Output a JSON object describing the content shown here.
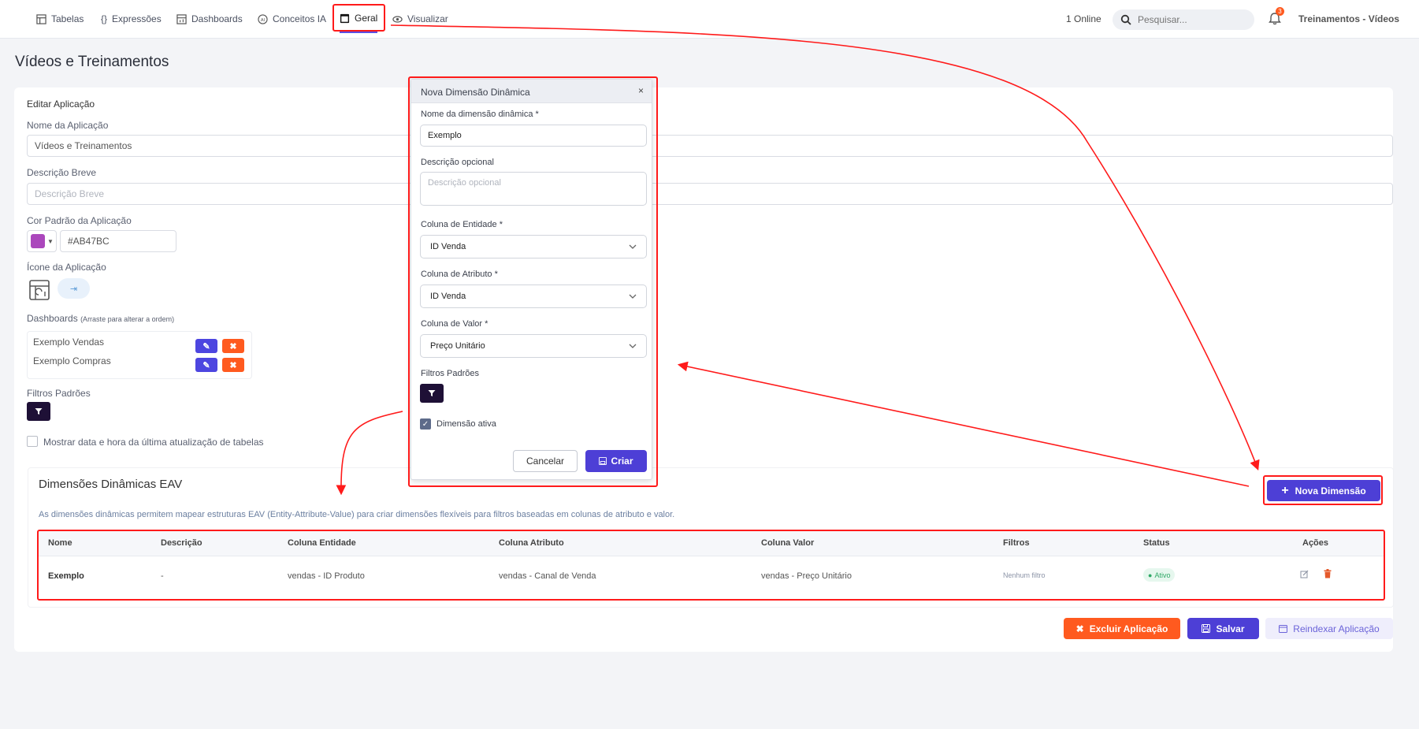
{
  "nav": {
    "items": [
      {
        "label": "Tabelas",
        "icon": "table-icon"
      },
      {
        "label": "Expressões",
        "icon": "braces-icon"
      },
      {
        "label": "Dashboards",
        "icon": "dashboard-icon"
      },
      {
        "label": "Conceitos IA",
        "icon": "ai-icon"
      },
      {
        "label": "Geral",
        "icon": "window-icon",
        "active": true
      },
      {
        "label": "Visualizar",
        "icon": "eye-icon"
      }
    ],
    "online": "1 Online",
    "search_placeholder": "Pesquisar...",
    "notifications_count": "3",
    "app_name": "Treinamentos - Vídeos"
  },
  "page": {
    "title": "Vídeos e Treinamentos"
  },
  "form": {
    "section_title": "Editar Aplicação",
    "name_label": "Nome da Aplicação",
    "name_value": "Vídeos e Treinamentos",
    "desc_label": "Descrição Breve",
    "desc_placeholder": "Descrição Breve",
    "color_label": "Cor Padrão da Aplicação",
    "color_hex": "#AB47BC",
    "icon_label": "Ícone da Aplicação",
    "icon_action": "⇥",
    "dashboards_label": "Dashboards",
    "dashboards_hint": "(Arraste para alterar a ordem)",
    "dashboards": [
      "Exemplo Vendas",
      "Exemplo Compras"
    ],
    "filters_label": "Filtros Padrões",
    "show_update_label": "Mostrar data e hora da última atualização de tabelas"
  },
  "eav": {
    "title": "Dimensões Dinâmicas EAV",
    "description": "As dimensões dinâmicas permitem mapear estruturas EAV (Entity-Attribute-Value) para criar dimensões flexíveis para filtros baseadas em colunas de atributo e valor.",
    "new_button": "Nova Dimensão",
    "columns": [
      "Nome",
      "Descrição",
      "Coluna Entidade",
      "Coluna Atributo",
      "Coluna Valor",
      "Filtros",
      "Status",
      "Ações"
    ],
    "rows": [
      {
        "nome": "Exemplo",
        "descricao": "-",
        "entidade": "vendas - ID Produto",
        "atributo": "vendas - Canal de Venda",
        "valor": "vendas - Preço Unitário",
        "filtros": "Nenhum filtro",
        "status": "Ativo"
      }
    ]
  },
  "footer": {
    "delete_label": "Excluir Aplicação",
    "save_label": "Salvar",
    "reindex_label": "Reindexar Aplicação"
  },
  "modal": {
    "title": "Nova Dimensão Dinâmica",
    "close": "×",
    "name_label": "Nome da dimensão dinâmica *",
    "name_value": "Exemplo",
    "desc_label": "Descrição opcional",
    "desc_placeholder": "Descrição opcional",
    "entity_label": "Coluna de Entidade *",
    "entity_value": "ID Venda",
    "attr_label": "Coluna de Atributo *",
    "attr_value": "ID Venda",
    "value_label": "Coluna de Valor *",
    "value_value": "Preço Unitário",
    "filters_label": "Filtros Padrões",
    "active_label": "Dimensão ativa",
    "cancel_label": "Cancelar",
    "create_label": "Criar"
  },
  "colors": {
    "accent": "#4d3fd6",
    "danger": "#ff5a1f",
    "app_color": "#AB47BC",
    "annotation": "#ff1a1a"
  }
}
